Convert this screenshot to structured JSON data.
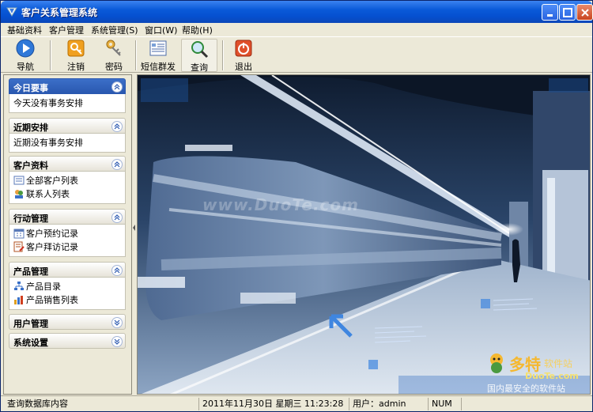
{
  "window": {
    "title": "客户关系管理系统"
  },
  "menu": [
    "基础资料",
    "客户管理",
    "系统管理(S)",
    "窗口(W)",
    "帮助(H)"
  ],
  "toolbar": {
    "nav": "导航",
    "logout": "注销",
    "password": "密码",
    "sms": "短信群发",
    "query": "查询",
    "exit": "退出"
  },
  "sidebar": {
    "today": {
      "title": "今日要事",
      "text": "今天没有事务安排"
    },
    "recent": {
      "title": "近期安排",
      "text": "近期没有事务安排"
    },
    "customers": {
      "title": "客户资料",
      "items": [
        "全部客户列表",
        "联系人列表"
      ]
    },
    "actions": {
      "title": "行动管理",
      "items": [
        "客户预约记录",
        "客户拜访记录"
      ]
    },
    "products": {
      "title": "产品管理",
      "items": [
        "产品目录",
        "产品销售列表"
      ]
    },
    "users": {
      "title": "用户管理"
    },
    "settings": {
      "title": "系统设置"
    }
  },
  "watermark": {
    "url": "www.DuoTe.com",
    "brand": "多特",
    "brand_suffix": "软件站",
    "brand_site": "DuoTe.com",
    "slogan": "国内最安全的软件站"
  },
  "status": {
    "message": "查询数据库内容",
    "datetime": "2011年11月30日  星期三  11:23:28",
    "user": "用户：admin",
    "num": "NUM"
  },
  "colors": {
    "titlebar": "#0a5ad8",
    "active_group": "#2a58b0",
    "chrome": "#ece9d8"
  }
}
